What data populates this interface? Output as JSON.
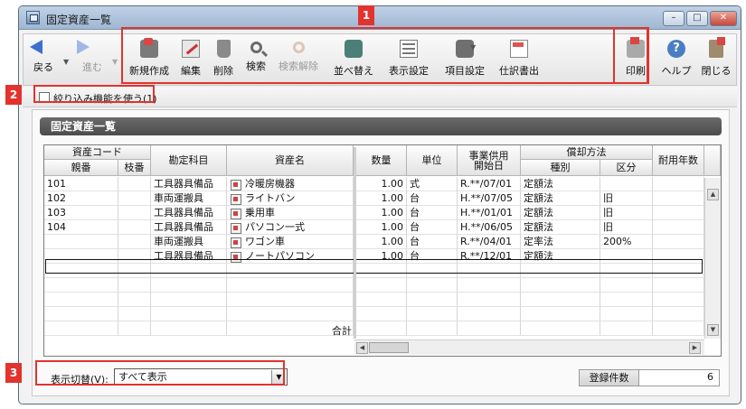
{
  "window": {
    "title": "固定資産一覧",
    "buttons": {
      "minimize": "–",
      "maximize": "□",
      "close": "✕"
    }
  },
  "toolbar": {
    "back": "戻る",
    "forward": "進む",
    "new": "新規作成",
    "edit": "編集",
    "delete": "削除",
    "search": "検索",
    "release": "検索解除",
    "sort": "並べ替え",
    "display_settings": "表示設定",
    "item_settings": "項目設定",
    "journal": "仕訳書出",
    "print": "印刷",
    "help": "ヘルプ",
    "close": "閉じる"
  },
  "filter": {
    "label": "絞り込み機能を使う(1)",
    "checked": false
  },
  "panel": {
    "title": "固定資産一覧"
  },
  "grid": {
    "headers": {
      "asset_code": "資産コード",
      "parent_no": "親番",
      "branch_no": "枝番",
      "account": "勘定科目",
      "asset_name": "資産名",
      "quantity": "数量",
      "unit": "単位",
      "service_start": "事業供用\n開始日",
      "depreciation_method": "償却方法",
      "type": "種別",
      "division": "区分",
      "useful_life": "耐用年数"
    },
    "rows": [
      {
        "parent": "101",
        "branch": "",
        "account": "工具器具備品",
        "name": "冷暖房機器",
        "qty": "1.00",
        "unit": "式",
        "start": "R.**/07/01",
        "type": "定額法",
        "division": ""
      },
      {
        "parent": "102",
        "branch": "",
        "account": "車両運搬具",
        "name": "ライトバン",
        "qty": "1.00",
        "unit": "台",
        "start": "H.**/07/05",
        "type": "定額法",
        "division": "旧"
      },
      {
        "parent": "103",
        "branch": "",
        "account": "工具器具備品",
        "name": "乗用車",
        "qty": "1.00",
        "unit": "台",
        "start": "H.**/01/01",
        "type": "定額法",
        "division": "旧"
      },
      {
        "parent": "104",
        "branch": "",
        "account": "工具器具備品",
        "name": "パソコン一式",
        "qty": "1.00",
        "unit": "台",
        "start": "H.**/06/05",
        "type": "定額法",
        "division": "旧"
      },
      {
        "parent": "",
        "branch": "",
        "account": "車両運搬具",
        "name": "ワゴン車",
        "qty": "1.00",
        "unit": "台",
        "start": "R.**/04/01",
        "type": "定率法",
        "division": "200%"
      },
      {
        "parent": "",
        "branch": "",
        "account": "工具器具備品",
        "name": "ノートパソコン",
        "qty": "1.00",
        "unit": "台",
        "start": "R.**/12/01",
        "type": "定額法",
        "division": ""
      }
    ],
    "total_label": "合計"
  },
  "footer": {
    "view_label": "表示切替(V):",
    "view_selected": "すべて表示",
    "count_label": "登録件数",
    "count_value": "6"
  },
  "callouts": [
    "1",
    "2",
    "3"
  ],
  "colors": {
    "callout": "#e2332e",
    "header_bar": "#555555"
  }
}
